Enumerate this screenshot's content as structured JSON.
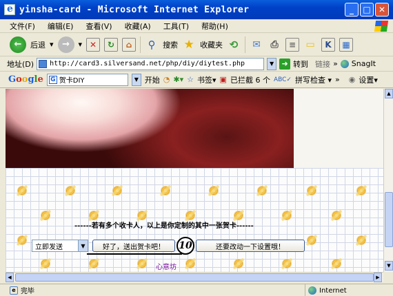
{
  "window": {
    "title": "yinsha-card - Microsoft Internet Explorer"
  },
  "menu": [
    "文件(F)",
    "编辑(E)",
    "查看(V)",
    "收藏(A)",
    "工具(T)",
    "帮助(H)"
  ],
  "toolbar": {
    "back_label": "后退",
    "search_label": "搜索",
    "favorites_label": "收藏夹"
  },
  "address": {
    "label": "地址(D)",
    "url": "http://card3.silversand.net/php/diy/diytest.php",
    "go_label": "转到",
    "links_label": "链接",
    "snagit_label": "SnagIt"
  },
  "google": {
    "input_value": "贺卡DIY",
    "search_label": "开始",
    "bookmarks_label": "书签▾",
    "blocked_label": "已拦截 6 个",
    "spellcheck_label": "拼写检查 ▾",
    "settings_label": "设置▾"
  },
  "card": {
    "message": "------若有多个收卡人，以上是你定制的其中一张贺卡------",
    "send_select_value": "立即发送",
    "send_button_label": "好了，送出贺卡吧！",
    "change_button_label": "还要改动一下设置哦！",
    "marker": "10",
    "site_link": "心意坊"
  },
  "status": {
    "text": "完毕",
    "zone": "Internet"
  },
  "colors": {
    "titlebar": "#0040c8",
    "link": "#7a1aa0"
  }
}
